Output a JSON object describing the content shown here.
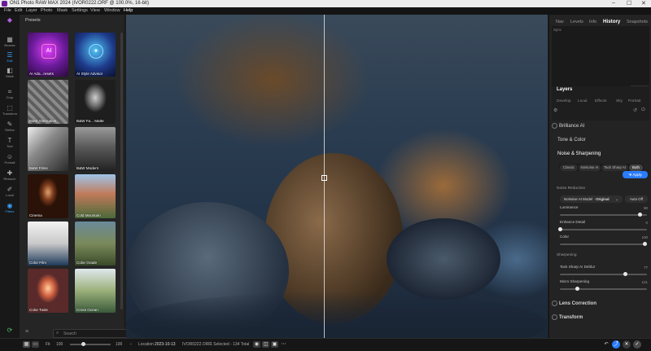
{
  "window": {
    "title": "ON1 Photo RAW MAX 2024 (IVOR0222.ORF @ 100.0%, 16-bit)",
    "controls": [
      "–",
      "☐",
      "✕"
    ]
  },
  "menu": [
    "File",
    "Edit",
    "Layer",
    "Photo",
    "Mask",
    "Settings",
    "View",
    "Window",
    "Help"
  ],
  "rail": [
    "Browse",
    "Edit",
    "Mask",
    "Crop",
    "Transform",
    "Refine",
    "Text",
    "Portrait",
    "Retouch",
    "Local",
    "Filters"
  ],
  "presets": {
    "header": "Presets",
    "tiles": [
      "AI Ada...resets",
      "AI Style Advisor",
      "B&W Alternative",
      "B&W Fa... Matte",
      "B&W Films",
      "B&W Modern",
      "Cinema",
      "Cold Mountain",
      "Color Film",
      "Color Grade",
      "Color Twist",
      "Cross Ocean"
    ],
    "search_placeholder": "Search"
  },
  "right": {
    "tabs": [
      "Nav",
      "Levels",
      "Info",
      "History",
      "Snapshots"
    ],
    "history_status": "Sync",
    "revert": "Revert",
    "layers": "Layers",
    "subtabs": [
      "Develop",
      "Local",
      "Effects",
      "Sky",
      "Portrait"
    ],
    "brilliance": "Brilliance AI",
    "tone": "Tone & Color",
    "noise_title": "Noise & Sharpening",
    "modes": [
      "Classic",
      "NoNoise AI",
      "Tack Sharp AI",
      "Both"
    ],
    "apply": "Apply",
    "noise_reduction": "Noise Reduction",
    "model_label": "NoNoise AI Model",
    "model_value": "Original",
    "auto_off": "Auto Off",
    "sliders": [
      {
        "label": "Luminance",
        "value": "90",
        "level": 0.92
      },
      {
        "label": "Enhance Detail",
        "value": "0",
        "level": 0.0
      },
      {
        "label": "Color",
        "value": "100",
        "level": 0.98
      }
    ],
    "sharpening": "Sharpening",
    "sharp_sliders": [
      {
        "label": "Tack Sharp AI Deblur",
        "value": "77",
        "level": 0.75
      },
      {
        "label": "Micro Sharpening",
        "value": "121",
        "level": 0.2
      }
    ],
    "lens": "Lens Correction",
    "transform": "Transform"
  },
  "status": {
    "fit_label": "Fit",
    "zoom": "100",
    "zoom2": "100",
    "location_label": "Location",
    "date": "2023-10-13",
    "file": "IVOR0222.ORF",
    "selection": "1 Selected - 134 Total"
  },
  "colors": {
    "accent": "#2a7cff",
    "panel": "#232323"
  }
}
